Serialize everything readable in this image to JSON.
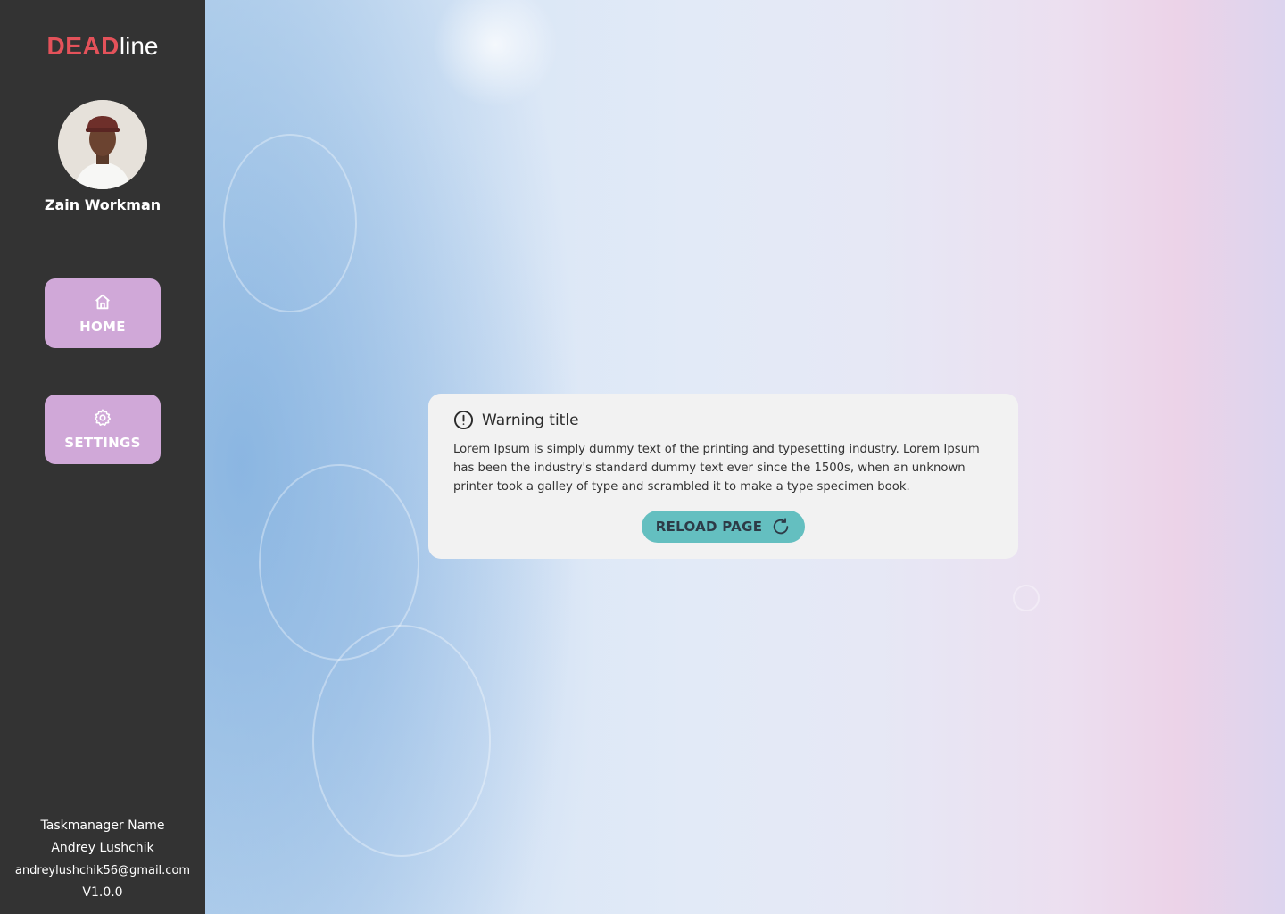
{
  "app": {
    "logo_primary": "DEAD",
    "logo_secondary": "line",
    "brand_color": "#e4525a"
  },
  "user": {
    "name": "Zain Workman"
  },
  "nav": {
    "items": [
      {
        "label": "HOME",
        "icon": "home-icon"
      },
      {
        "label": "SETTINGS",
        "icon": "gear-icon"
      }
    ],
    "button_color": "#d0a8d8"
  },
  "footer": {
    "app_name": "Taskmanager Name",
    "author": "Andrey Lushchik",
    "email": "andreylushchik56@gmail.com",
    "version": "V1.0.0"
  },
  "warning": {
    "title": "Warning title",
    "icon": "exclamation-circle-icon",
    "message": "Lorem Ipsum is simply dummy text of the printing and typesetting industry. Lorem Ipsum has been the industry's standard dummy text ever since the 1500s, when an unknown printer took a galley of type and scrambled it to make a type specimen book.",
    "button_label": "RELOAD PAGE",
    "button_icon": "reload-icon",
    "button_color": "#64bfc0"
  }
}
